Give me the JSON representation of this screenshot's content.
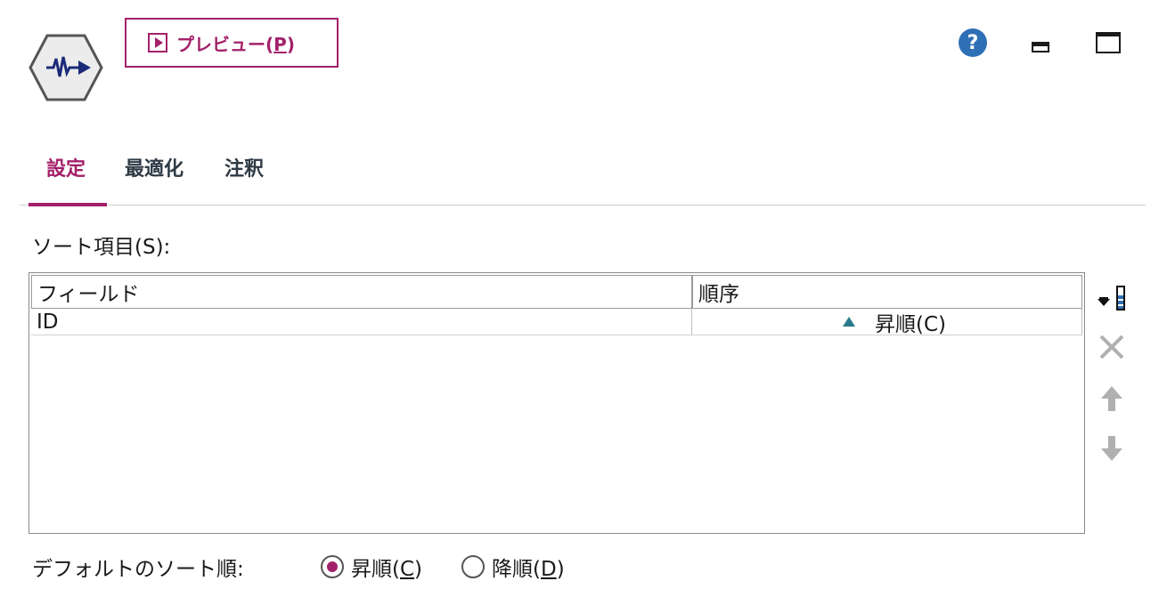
{
  "header": {
    "preview_button": {
      "label_prefix": "プレビュー(",
      "mnemonic": "P",
      "label_suffix": ")"
    },
    "help_glyph": "?"
  },
  "tabs": [
    {
      "label": "設定",
      "active": true
    },
    {
      "label": "最適化",
      "active": false
    },
    {
      "label": "注釈",
      "active": false
    }
  ],
  "sort": {
    "label": "ソート項目(S):",
    "columns": [
      "フィールド",
      "順序"
    ],
    "rows": [
      {
        "field": "ID",
        "order": "昇順(C)"
      }
    ]
  },
  "default_order": {
    "label": "デフォルトのソート順:",
    "options": [
      {
        "prefix": "昇順(",
        "mnemonic": "C",
        "suffix": ")",
        "selected": true
      },
      {
        "prefix": "降順(",
        "mnemonic": "D",
        "suffix": ")",
        "selected": false
      }
    ]
  },
  "colors": {
    "accent": "#a3216a",
    "help": "#2f6fb5",
    "node_icon": "#1c2a7a",
    "asc_marker": "#2a7a8c"
  },
  "icons": [
    "sort-node-icon",
    "play-icon",
    "help-icon",
    "minimize-icon",
    "maximize-icon",
    "add-field-icon",
    "delete-icon",
    "move-up-icon",
    "move-down-icon",
    "ascending-triangle-icon"
  ]
}
